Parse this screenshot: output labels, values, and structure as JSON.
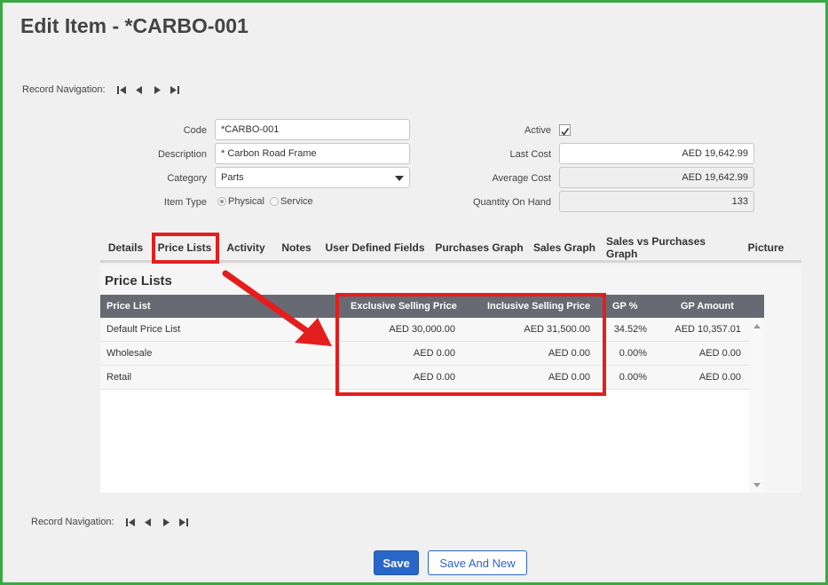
{
  "page_title": "Edit Item - *CARBO-001",
  "record_navigation": {
    "label": "Record Navigation:",
    "icons": [
      "first-record-icon",
      "previous-record-icon",
      "next-record-icon",
      "last-record-icon"
    ]
  },
  "form": {
    "code": {
      "label": "Code",
      "value": "*CARBO-001"
    },
    "description": {
      "label": "Description",
      "value": "* Carbon Road Frame"
    },
    "category": {
      "label": "Category",
      "value": "Parts"
    },
    "item_type": {
      "label": "Item Type",
      "options": [
        "Physical",
        "Service"
      ],
      "selected": "Physical"
    },
    "active": {
      "label": "Active",
      "checked": true
    },
    "last_cost": {
      "label": "Last Cost",
      "value": "AED 19,642.99"
    },
    "average_cost": {
      "label": "Average Cost",
      "value": "AED 19,642.99"
    },
    "quantity_on_hand": {
      "label": "Quantity On Hand",
      "value": "133"
    }
  },
  "tabs": [
    "Details",
    "Price Lists",
    "Activity",
    "Notes",
    "User Defined Fields",
    "Purchases Graph",
    "Sales Graph",
    "Sales vs Purchases Graph",
    "Picture"
  ],
  "active_tab": "Price Lists",
  "price_lists": {
    "title": "Price Lists",
    "columns": [
      "Price List",
      "Exclusive Selling Price",
      "Inclusive Selling Price",
      "GP %",
      "GP Amount"
    ],
    "rows": [
      [
        "Default Price List",
        "AED 30,000.00",
        "AED 31,500.00",
        "34.52%",
        "AED 10,357.01"
      ],
      [
        "Wholesale",
        "AED 0.00",
        "AED 0.00",
        "0.00%",
        "AED 0.00"
      ],
      [
        "Retail",
        "AED 0.00",
        "AED 0.00",
        "0.00%",
        "AED 0.00"
      ]
    ]
  },
  "buttons": {
    "save": "Save",
    "save_and_new": "Save And New"
  },
  "colors": {
    "frame_border": "#3aa843",
    "highlight": "#e41e1e",
    "grid_header": "#676a72",
    "primary_button": "#2a66c7"
  }
}
